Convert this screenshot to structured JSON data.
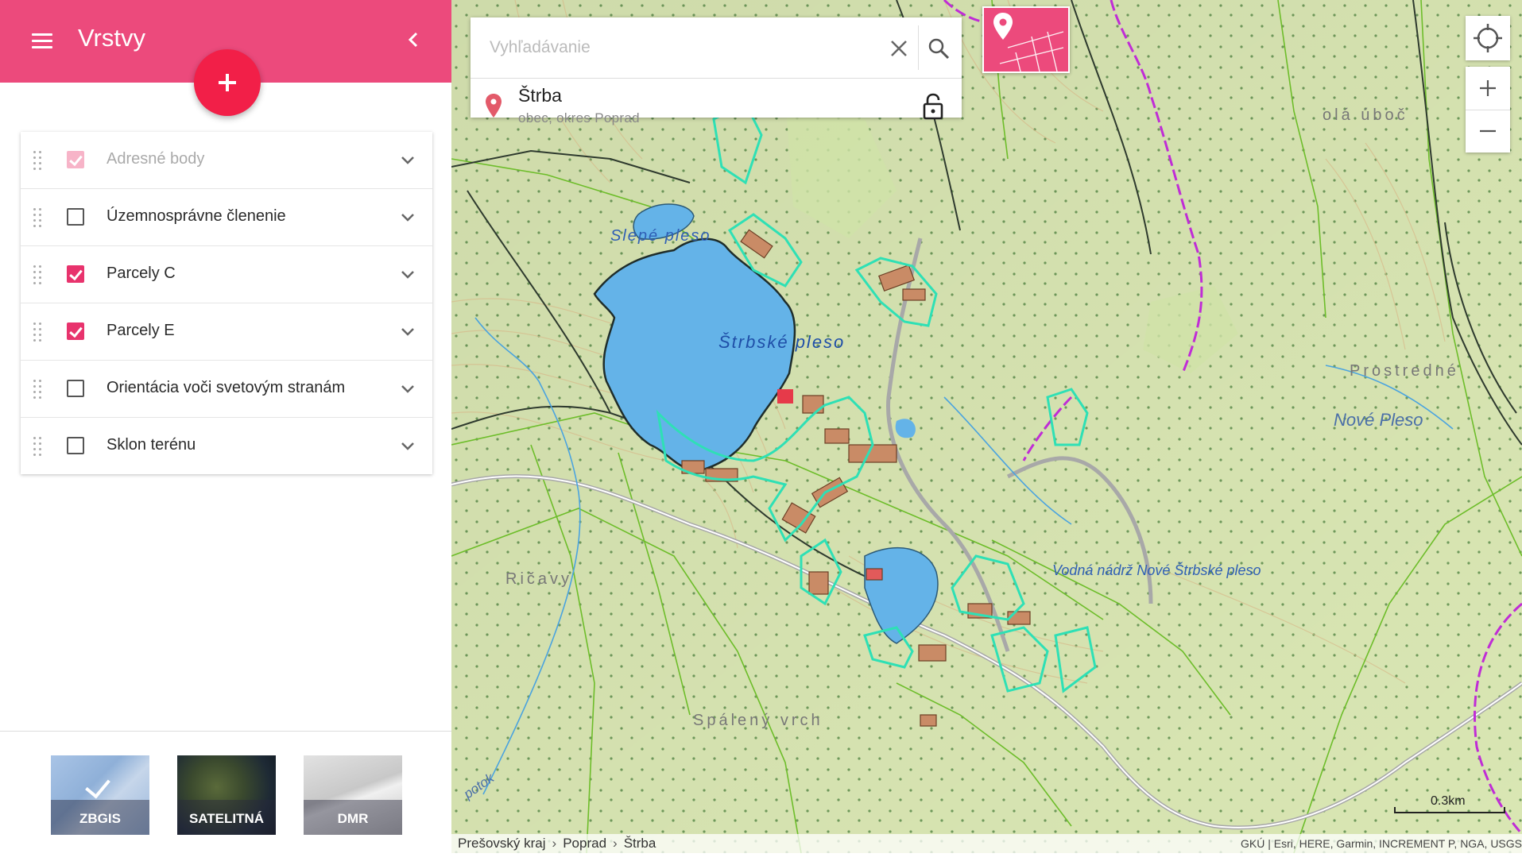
{
  "sidebar": {
    "title": "Vrstvy",
    "menu_icon": "hamburger-icon",
    "collapse_icon": "chevron-left-icon",
    "add_icon": "plus-icon",
    "accent_color": "#ec4a7c",
    "layers": [
      {
        "label": "Adresné body",
        "checked": true,
        "disabled": true
      },
      {
        "label": "Územnosprávne členenie",
        "checked": false,
        "disabled": false
      },
      {
        "label": "Parcely C",
        "checked": true,
        "disabled": false
      },
      {
        "label": "Parcely E",
        "checked": true,
        "disabled": false
      },
      {
        "label": "Orientácia voči svetovým stranám",
        "checked": false,
        "disabled": false
      },
      {
        "label": "Sklon terénu",
        "checked": false,
        "disabled": false
      }
    ],
    "basemaps": [
      {
        "label": "ZBGIS",
        "selected": true
      },
      {
        "label": "SATELITNÁ",
        "selected": false
      },
      {
        "label": "DMR",
        "selected": false
      }
    ]
  },
  "search": {
    "placeholder": "Vyhľadávanie",
    "value": "",
    "result": {
      "name": "Štrba",
      "subtitle": "obec, okres Poprad"
    }
  },
  "map": {
    "labels": {
      "slepe_pleso": "Slepé pleso",
      "strbske_pleso": "Štrbské pleso",
      "vodna_nadrz": "Vodná nádrž Nové Štrbské pleso",
      "ricavy": "Ričavy",
      "spaleny_vrch": "Spálený vrch",
      "prostredne": "Prostredné",
      "nove_pleso": "Nové Pleso",
      "olau_uboc": "olá úboč",
      "potok": "potok"
    },
    "scale_label": "0.3km",
    "breadcrumb": [
      "Prešovský kraj",
      "Poprad",
      "Štrba"
    ],
    "attribution": "GKÚ | Esri, HERE, Garmin, INCREMENT P, NGA, USGS",
    "colors": {
      "terrain": "#d9e6b3",
      "water": "#64b3e8",
      "parcel_outline": "#2ee0b5",
      "boundary": "#c02cd6",
      "building": "#c98b66"
    }
  }
}
